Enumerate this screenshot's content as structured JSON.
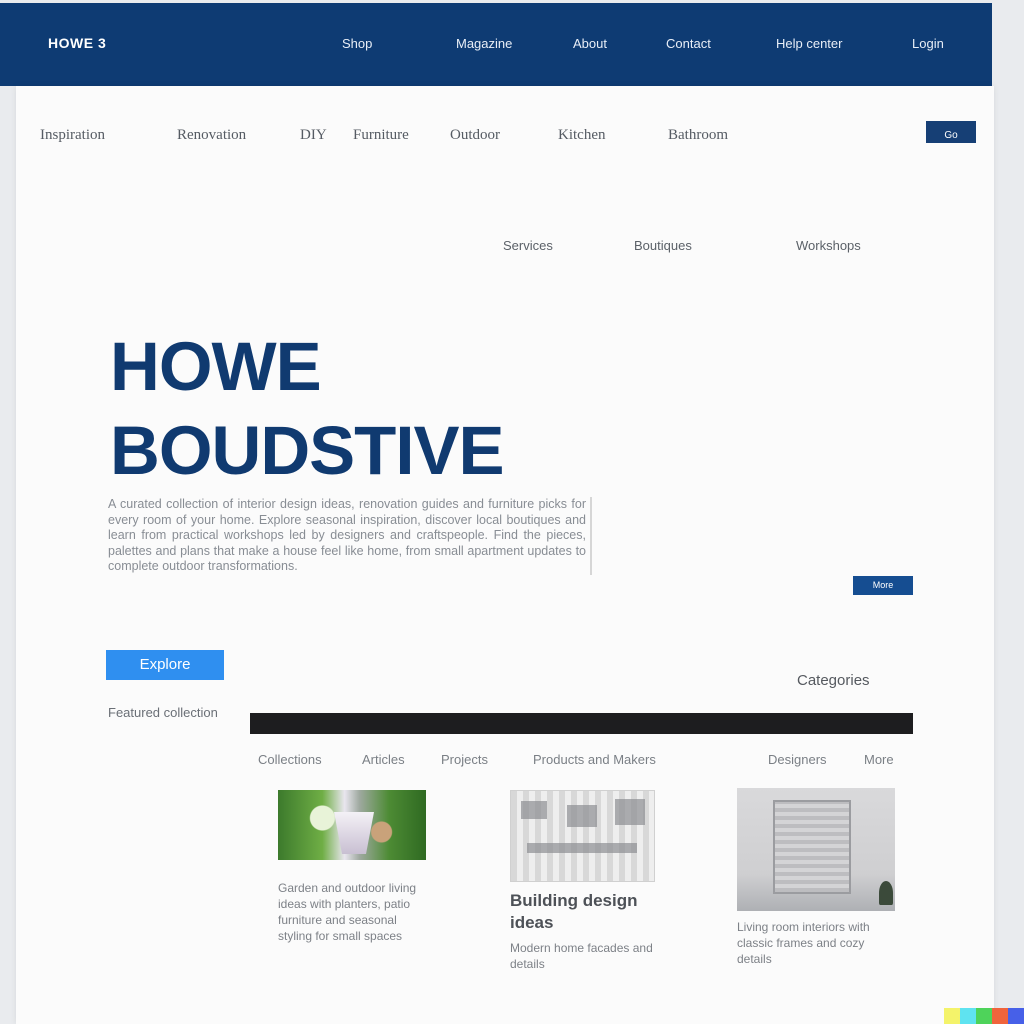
{
  "header": {
    "brand": "HOWE 3",
    "nav": [
      "Shop",
      "Magazine",
      "About",
      "Contact",
      "Help center",
      "Login"
    ]
  },
  "subnav": {
    "items": [
      "Inspiration",
      "Renovation",
      "DIY",
      "Furniture",
      "Outdoor",
      "Kitchen",
      "Bathroom"
    ],
    "button_label": "Go"
  },
  "minor_links": [
    "Services",
    "Boutiques",
    "Workshops"
  ],
  "hero": {
    "title_line1": "HOWE",
    "title_line2": "BOUDSTIVE",
    "paragraph": "A curated collection of interior design ideas, renovation guides and furniture picks for every room of your home. Explore seasonal inspiration, discover local boutiques and learn from practical workshops led by designers and craftspeople. Find the pieces, palettes and plans that make a house feel like home, from small apartment updates to complete outdoor transformations.",
    "small_button": "More",
    "cta_label": "Explore"
  },
  "side_link": "Categories",
  "section": {
    "label": "Featured collection",
    "filters": [
      "Collections",
      "Articles",
      "Projects",
      "Products and Makers",
      "Designers",
      "More"
    ]
  },
  "cards": [
    {
      "caption": "Garden and outdoor living ideas with planters, patio furniture and seasonal styling for small spaces"
    },
    {
      "caption_big": "Building design ideas",
      "caption": "Modern home facades and details"
    },
    {
      "caption": "Living room interiors with classic frames and cozy details"
    }
  ],
  "colors": {
    "header_bg": "#0e3b73",
    "title": "#103a70",
    "cta": "#2f8ff0",
    "strip": [
      "#f4f36a",
      "#5fe3f0",
      "#4ed35a",
      "#f0643c",
      "#4760e8"
    ]
  }
}
